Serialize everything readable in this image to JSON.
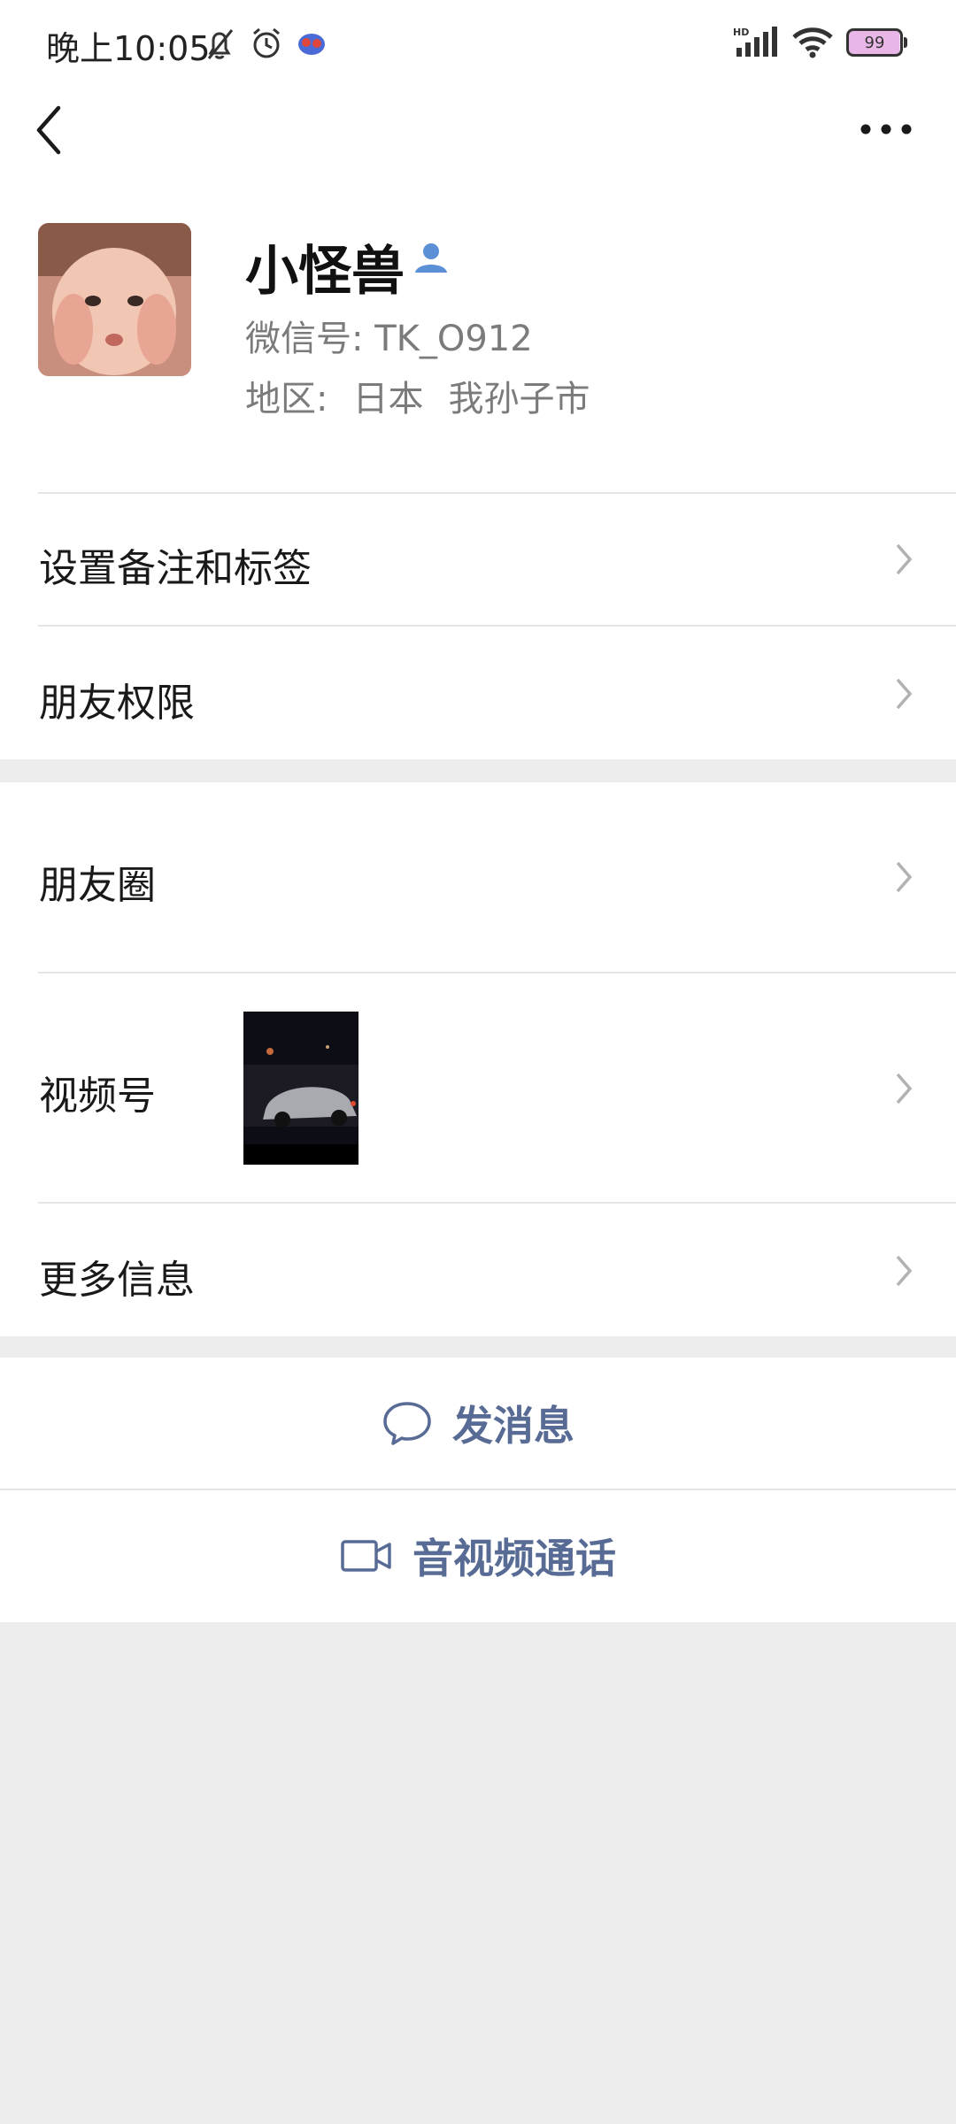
{
  "status_bar": {
    "time": "晚上10:05",
    "icons": [
      "bell-off-icon",
      "alarm-icon",
      "app-notification-icon",
      "hd-signal-icon",
      "wifi-icon",
      "battery-icon"
    ],
    "battery_level": "99"
  },
  "nav": {
    "back_icon": "chevron-left-icon",
    "more_icon": "ellipsis-icon"
  },
  "profile": {
    "name": "小怪兽",
    "wechat_id": "微信号:  TK_O912",
    "region_label": "地区:",
    "region_country": "日本",
    "region_city": "我孙子市"
  },
  "rows": {
    "remark_label": "设置备注和标签",
    "permissions_label": "朋友权限",
    "moments_label": "朋友圈",
    "channels_label": "视频号",
    "more_info_label": "更多信息"
  },
  "actions": {
    "message_label": "发消息",
    "call_label": "音视频通话"
  },
  "colors": {
    "accent_link": "#576b95",
    "background": "#ededed",
    "card": "#ffffff",
    "verified_icon": "#5b8fd6"
  }
}
